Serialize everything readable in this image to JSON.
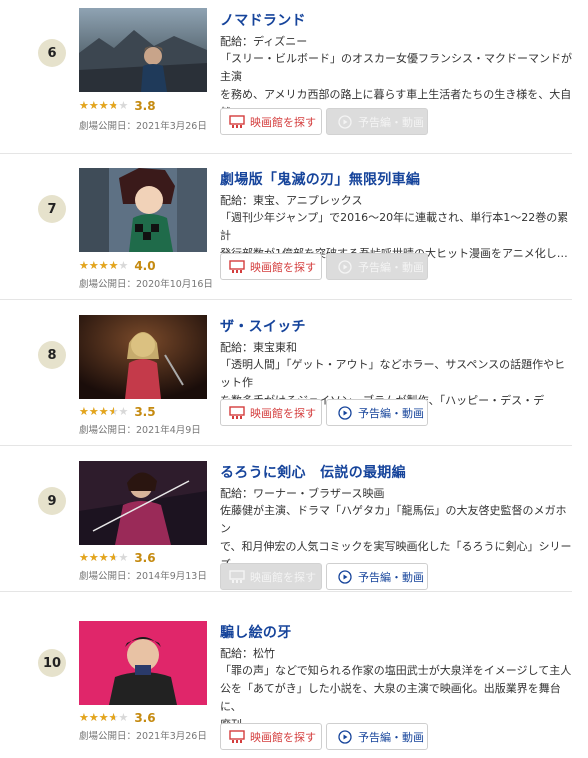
{
  "ui": {
    "distributor_prefix": "配給：",
    "release_prefix": "劇場公開日：",
    "theater_label": "映画館を探す",
    "trailer_label": "予告編・動画",
    "star_glyphs": "★★★★★"
  },
  "colors": {
    "title": "#16449b",
    "star": "#e4a51b",
    "theater_button": "#d43d3d",
    "disabled_button": "#dcdcdc"
  },
  "items": [
    {
      "rank": "6",
      "title": "ノマドランド",
      "distributor": "ディズニー",
      "description": "「スリー・ビルボード」のオスカー女優フランシス・マクドーマンドが主演\nを務め、アメリカ西部の路上に暮らす車上生活者たちの生き様を、大自\n然…",
      "score": "3.8",
      "rating": 3.8,
      "release_date": "2021年3月26日",
      "theater_enabled": true,
      "trailer_enabled": false
    },
    {
      "rank": "7",
      "title": "劇場版「鬼滅の刃」無限列車編",
      "distributor": "東宝、アニプレックス",
      "description": "「週刊少年ジャンプ」で2016～20年に連載され、単行本1～22巻の累計\n発行部数が1億部を突破する吾峠呼世晴の大ヒット漫画をアニメ化し…",
      "score": "4.0",
      "rating": 4.0,
      "release_date": "2020年10月16日",
      "theater_enabled": true,
      "trailer_enabled": false
    },
    {
      "rank": "8",
      "title": "ザ・スイッチ",
      "distributor": "東宝東和",
      "description": "「透明人間」「ゲット・アウト」などホラー、サスペンスの話題作やヒット作\nを数多手がけるジェイソン・ブラムが製作、「ハッピー・デス・デイ」…",
      "score": "3.5",
      "rating": 3.5,
      "release_date": "2021年4月9日",
      "theater_enabled": true,
      "trailer_enabled": true
    },
    {
      "rank": "9",
      "title": "るろうに剣心　伝説の最期編",
      "distributor": "ワーナー・ブラザース映画",
      "description": "佐藤健が主演、ドラマ「ハゲタカ」「龍馬伝」の大友啓史監督のメガホン\nで、和月伸宏の人気コミックを実写映画化した「るろうに剣心」シリーズ\nの…",
      "score": "3.6",
      "rating": 3.6,
      "release_date": "2014年9月13日",
      "theater_enabled": false,
      "trailer_enabled": true
    },
    {
      "rank": "10",
      "title": "騙し絵の牙",
      "distributor": "松竹",
      "description": "「罪の声」などで知られる作家の塩田武士が大泉洋をイメージして主人\n公を「あてがき」した小説を、大泉の主演で映画化。出版業界を舞台に、\n廃刊…",
      "score": "3.6",
      "rating": 3.6,
      "release_date": "2021年3月26日",
      "theater_enabled": true,
      "trailer_enabled": true
    }
  ]
}
